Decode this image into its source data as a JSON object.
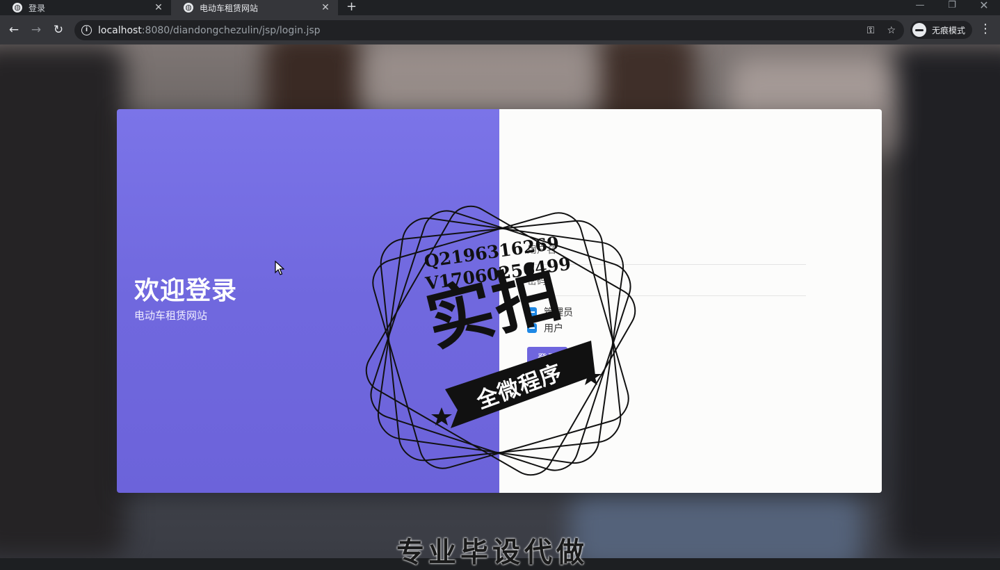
{
  "browser": {
    "tabs": [
      {
        "title": "登录",
        "active": false
      },
      {
        "title": "电动车租赁网站",
        "active": true
      }
    ],
    "new_tab": "+",
    "url_host": "localhost",
    "url_path": ":8080/diandongchezulin/jsp/login.jsp",
    "incognito_label": "无痕模式"
  },
  "page": {
    "welcome_title": "欢迎登录",
    "welcome_subtitle": "电动车租赁网站",
    "username_placeholder": "用户名",
    "password_placeholder": "密码",
    "roles": [
      "管理员",
      "用户"
    ],
    "login_button": "登录",
    "accent_color": "#6f66de"
  },
  "watermark": {
    "line_q": "Q2196316269",
    "line_v": "V17060256499",
    "big_text": "实拍",
    "banner_text": "全微程序"
  },
  "caption": "专业毕设代做"
}
